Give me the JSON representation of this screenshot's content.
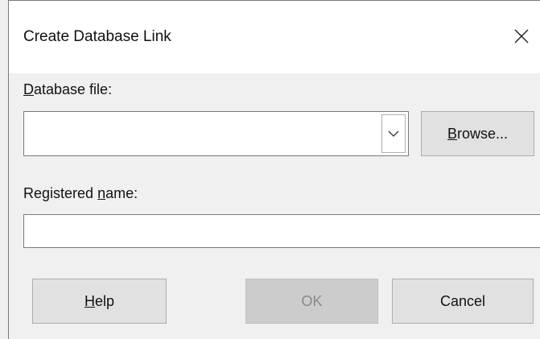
{
  "window": {
    "title": "Create Database Link"
  },
  "database_file": {
    "label_mnemonic": "D",
    "label_rest": "atabase file:",
    "value": ""
  },
  "registered_name": {
    "label_before": "Registered ",
    "label_mnemonic": "n",
    "label_after": "ame:",
    "value": ""
  },
  "buttons": {
    "browse_mnemonic": "B",
    "browse_rest": "rowse...",
    "help_mnemonic": "H",
    "help_rest": "elp",
    "ok": "OK",
    "cancel": "Cancel"
  },
  "icons": {
    "close": "close-icon",
    "dropdown": "chevron-down-icon"
  }
}
